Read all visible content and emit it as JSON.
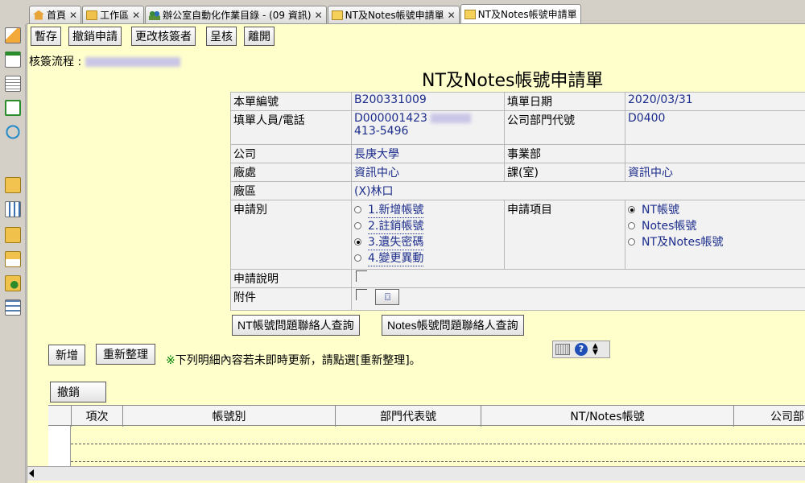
{
  "tabs": [
    {
      "label": "首頁",
      "icon": "home-icon",
      "active": false
    },
    {
      "label": "工作區",
      "icon": "folder-icon",
      "active": false
    },
    {
      "label": "辦公室自動化作業目錄 - (09 資訊)",
      "icon": "people-icon",
      "active": false
    },
    {
      "label": "NT及Notes帳號申請單",
      "icon": "form-icon",
      "active": false
    },
    {
      "label": "NT及Notes帳號申請單",
      "icon": "form-icon",
      "active": true
    }
  ],
  "actions": {
    "save": "暫存",
    "withdraw": "撤銷申請",
    "change_signer": "更改核簽者",
    "submit": "呈核",
    "leave": "離開"
  },
  "flow": {
    "label": "核簽流程 :"
  },
  "form": {
    "title": "NT及Notes帳號申請單",
    "doc_no_label": "本單編號",
    "doc_no": "B200331009",
    "date_label": "填單日期",
    "date": "2020/03/31",
    "applicant_label": "填單人員/電話",
    "applicant_id": "D000001423",
    "applicant_phone": "413-5496",
    "dept_code_label": "公司部門代號",
    "dept_code": "D0400",
    "company_label": "公司",
    "company": "長庚大學",
    "division_label": "事業部",
    "division": "",
    "plant_label": "廠處",
    "plant": "資訊中心",
    "section_label": "課(室)",
    "section": "資訊中心",
    "area_label": "廠區",
    "area": "(X)林口",
    "type_label": "申請別",
    "types": [
      {
        "label": "1.新增帳號",
        "checked": false
      },
      {
        "label": "2.註銷帳號",
        "checked": false
      },
      {
        "label": "3.遺失密碼",
        "checked": true
      },
      {
        "label": "4.變更異動",
        "checked": false
      }
    ],
    "item_label": "申請項目",
    "items": [
      {
        "label": "NT帳號",
        "checked": true
      },
      {
        "label": "Notes帳號",
        "checked": false
      },
      {
        "label": "NT及Notes帳號",
        "checked": false
      }
    ],
    "desc_label": "申請說明",
    "attach_label": "附件"
  },
  "query": {
    "nt_contact": "NT帳號問題聯絡人查詢",
    "notes_contact": "Notes帳號問題聯絡人查詢"
  },
  "detail": {
    "add": "新增",
    "refresh": "重新整理",
    "note_mark": "※",
    "note": "下列明細內容若未即時更新，請點選[重新整理]。",
    "cancel": "撤銷",
    "columns": [
      "項次",
      "帳號別",
      "部門代表號",
      "NT/Notes帳號",
      "公司部"
    ]
  }
}
